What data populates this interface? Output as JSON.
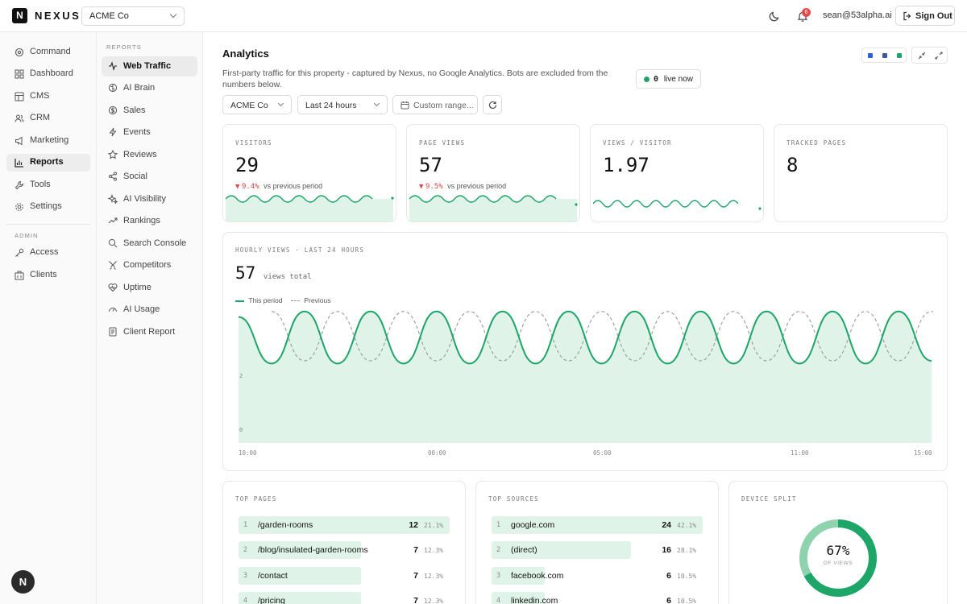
{
  "brand": {
    "logo_letter": "N",
    "name": "NEXUS"
  },
  "org_select": {
    "value": "ACME Co"
  },
  "header": {
    "notifications_count": "6",
    "user_email": "sean@53alpha.ai",
    "signout_label": "Sign Out"
  },
  "sidebar": {
    "items": [
      {
        "label": "Command",
        "icon": "command-icon"
      },
      {
        "label": "Dashboard",
        "icon": "dashboard-icon"
      },
      {
        "label": "CMS",
        "icon": "cms-icon"
      },
      {
        "label": "CRM",
        "icon": "users-icon"
      },
      {
        "label": "Marketing",
        "icon": "megaphone-icon"
      },
      {
        "label": "Reports",
        "icon": "bar-chart-icon",
        "active": true
      },
      {
        "label": "Tools",
        "icon": "wrench-icon"
      },
      {
        "label": "Settings",
        "icon": "gear-icon"
      }
    ],
    "admin_section": "ADMIN",
    "admin_items": [
      {
        "label": "Access",
        "icon": "key-icon"
      },
      {
        "label": "Clients",
        "icon": "building-icon"
      }
    ],
    "avatar_letter": "N"
  },
  "subnav": {
    "section": "REPORTS",
    "items": [
      {
        "label": "Web Traffic",
        "active": true
      },
      {
        "label": "AI Brain"
      },
      {
        "label": "Sales"
      },
      {
        "label": "Events"
      },
      {
        "label": "Reviews"
      },
      {
        "label": "Social"
      },
      {
        "label": "AI Visibility"
      },
      {
        "label": "Rankings"
      },
      {
        "label": "Search Console"
      },
      {
        "label": "Competitors"
      },
      {
        "label": "Uptime"
      },
      {
        "label": "AI Usage"
      },
      {
        "label": "Client Report"
      }
    ]
  },
  "main": {
    "title": "Analytics",
    "description": "First-party traffic for this property - captured by Nexus, no Google Analytics. Bots are excluded from the numbers below.",
    "live_count": "0",
    "live_label": "live now",
    "swatches": [
      "#2f5fd6",
      "#3b5998",
      "#1ea568"
    ],
    "filters": {
      "property": "ACME Co",
      "range": "Last 24 hours",
      "custom": "Custom range..."
    }
  },
  "stats": [
    {
      "label": "VISITORS",
      "value": "29",
      "delta": "9.4%",
      "delta_suffix": "vs previous period"
    },
    {
      "label": "PAGE VIEWS",
      "value": "57",
      "delta": "9.5%",
      "delta_suffix": "vs previous period"
    },
    {
      "label": "VIEWS / VISITOR",
      "value": "1.97"
    },
    {
      "label": "TRACKED PAGES",
      "value": "8"
    }
  ],
  "hourly": {
    "label": "HOURLY VIEWS · LAST 24 HOURS",
    "total": "57",
    "total_suffix": "views total",
    "legend_current": "This period",
    "legend_previous": "Previous",
    "x_labels": [
      "10:00",
      "00:00",
      "05:00",
      "11:00",
      "15:00"
    ],
    "y_labels": [
      "2",
      "0"
    ]
  },
  "chart_data": {
    "type": "area",
    "title": "HOURLY VIEWS · LAST 24 HOURS",
    "x": [
      "10:00",
      "00:00",
      "05:00",
      "11:00",
      "15:00"
    ],
    "ylim": [
      0,
      5
    ],
    "series": [
      {
        "name": "This period",
        "style": "area",
        "values": [
          4.6,
          2.9,
          4.8,
          2.9,
          4.8,
          2.9,
          4.8,
          2.9,
          4.8,
          2.9,
          4.8,
          2.9,
          4.8,
          2.9,
          4.8,
          2.9,
          4.8,
          2.9,
          4.8,
          2.9,
          4.8,
          3.0
        ]
      },
      {
        "name": "Previous",
        "style": "dashed",
        "values": [
          4.8,
          3.0,
          4.8,
          3.0,
          4.8,
          3.0,
          4.8,
          3.0,
          4.8,
          3.0,
          4.8,
          3.0,
          4.8,
          3.0,
          4.8,
          3.0,
          4.8,
          3.0,
          4.8,
          3.0,
          4.8,
          3.0
        ]
      }
    ],
    "grid": true,
    "legend": "top-left"
  },
  "top_pages": {
    "label": "TOP PAGES",
    "rows": [
      {
        "idx": "1",
        "name": "/garden-rooms",
        "count": "12",
        "pct": "21.1%",
        "share": 1.0
      },
      {
        "idx": "2",
        "name": "/blog/insulated-garden-rooms",
        "count": "7",
        "pct": "12.3%",
        "share": 0.58
      },
      {
        "idx": "3",
        "name": "/contact",
        "count": "7",
        "pct": "12.3%",
        "share": 0.58
      },
      {
        "idx": "4",
        "name": "/pricing",
        "count": "7",
        "pct": "12.3%",
        "share": 0.58
      }
    ]
  },
  "top_sources": {
    "label": "TOP SOURCES",
    "rows": [
      {
        "idx": "1",
        "name": "google.com",
        "count": "24",
        "pct": "42.1%",
        "share": 1.0
      },
      {
        "idx": "2",
        "name": "(direct)",
        "count": "16",
        "pct": "28.1%",
        "share": 0.66
      },
      {
        "idx": "3",
        "name": "facebook.com",
        "count": "6",
        "pct": "10.5%",
        "share": 0.25
      },
      {
        "idx": "4",
        "name": "linkedin.com",
        "count": "6",
        "pct": "10.5%",
        "share": 0.25
      }
    ]
  },
  "device_split": {
    "label": "DEVICE SPLIT",
    "percent": "67%",
    "sub": "OF VIEWS",
    "share": 0.67
  }
}
